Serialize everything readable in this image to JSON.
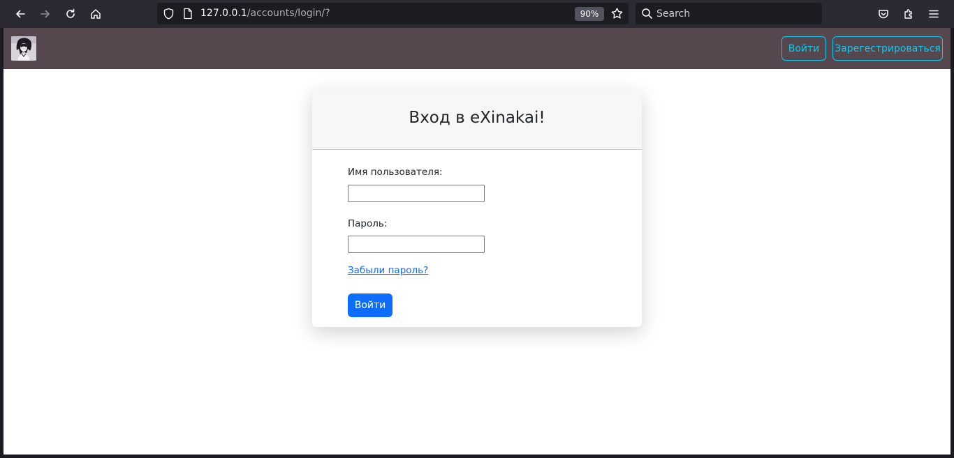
{
  "browser": {
    "url_host": "127.0.0.1",
    "url_path": "/accounts/login/?",
    "zoom": "90%",
    "search_placeholder": "Search",
    "icons": [
      "back-icon",
      "forward-icon",
      "reload-icon",
      "home-icon",
      "shield-icon",
      "page-icon",
      "bookmark-star-icon",
      "search-icon",
      "pocket-icon",
      "extensions-icon",
      "menu-icon"
    ]
  },
  "navbar": {
    "login_label": "Войти",
    "register_label": "Зарегестрироваться",
    "accent": "#0dcaf0",
    "background": "#54474d"
  },
  "login_card": {
    "title": "Вход в eXinakai!",
    "username_label": "Имя пользователя:",
    "username_value": "",
    "password_label": "Пароль:",
    "password_value": "",
    "forgot_link": "Забыли пароль?",
    "submit_label": "Войти",
    "submit_color": "#0d6efd"
  }
}
